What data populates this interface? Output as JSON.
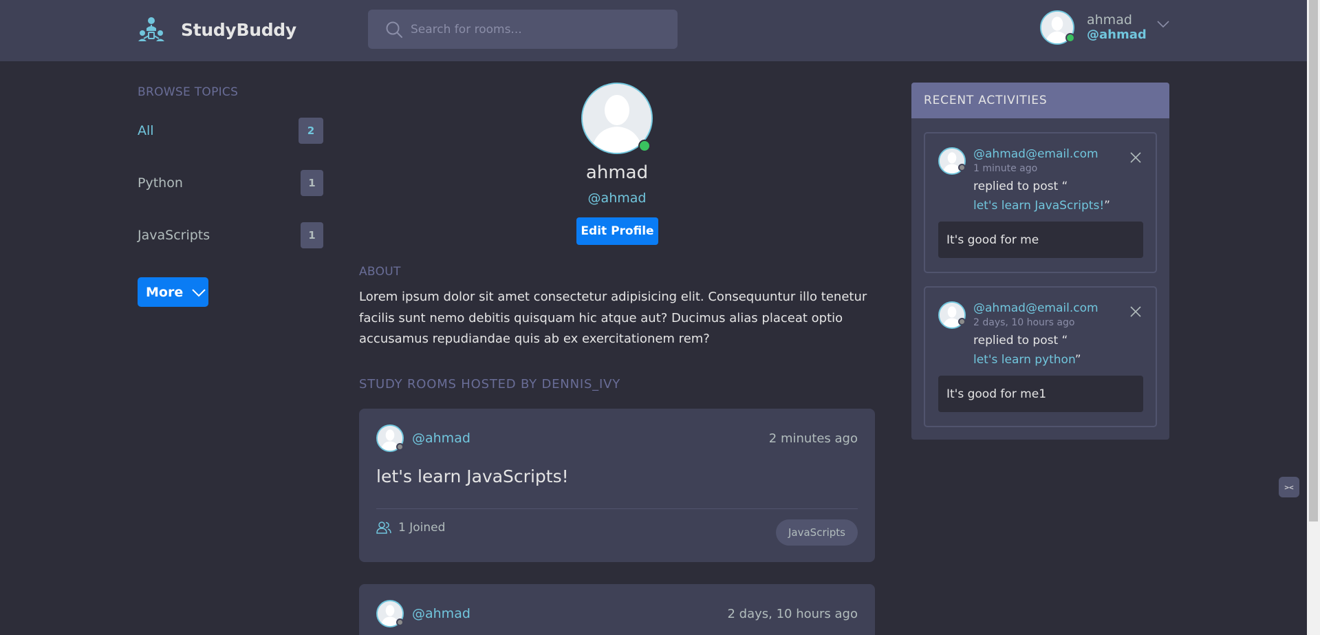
{
  "header": {
    "brand": "StudyBuddy",
    "search_placeholder": "Search for rooms...",
    "user_name": "ahmad",
    "user_handle": "@ahmad"
  },
  "sidebar": {
    "title": "BROWSE TOPICS",
    "topics": [
      {
        "label": "All",
        "count": "2"
      },
      {
        "label": "Python",
        "count": "1"
      },
      {
        "label": "JavaScripts",
        "count": "1"
      }
    ],
    "more_label": "More"
  },
  "profile": {
    "name": "ahmad",
    "handle": "@ahmad",
    "edit_label": "Edit Profile",
    "about_title": "ABOUT",
    "about_text": "Lorem ipsum dolor sit amet consectetur adipisicing elit. Consequuntur illo tenetur facilis sunt nemo debitis quisquam hic atque aut? Ducimus alias placeat optio accusamus repudiandae quis ab ex exercitationem rem?",
    "rooms_title": "STUDY ROOMS HOSTED BY DENNIS_IVY"
  },
  "rooms": [
    {
      "host": "@ahmad",
      "time": "2 minutes ago",
      "title": "let's learn JavaScripts!",
      "joined": "1 Joined",
      "topic": "JavaScripts"
    },
    {
      "host": "@ahmad",
      "time": "2 days, 10 hours ago"
    }
  ],
  "activities": {
    "title": "RECENT ACTIVITIES",
    "items": [
      {
        "user": "@ahmad@email.com",
        "time": "1 minute ago",
        "action": "replied to post “",
        "link": "let's learn JavaScripts!",
        "end": "”",
        "message": "It's good for me"
      },
      {
        "user": "@ahmad@email.com",
        "time": "2 days, 10 hours ago",
        "action": "replied to post “",
        "link": "let's learn python",
        "end": "”",
        "message": "It's good for me1"
      }
    ]
  },
  "colors": {
    "bg": "#2d2d39",
    "panel": "#3f4156",
    "accent": "#71c6dd",
    "primary": "#0a7cf4",
    "muted": "#696d97",
    "online": "#3ac15f"
  },
  "icons": [
    "logo-icon",
    "search-icon",
    "chevron-down-icon",
    "user-avatar-icon",
    "close-icon",
    "users-icon"
  ]
}
